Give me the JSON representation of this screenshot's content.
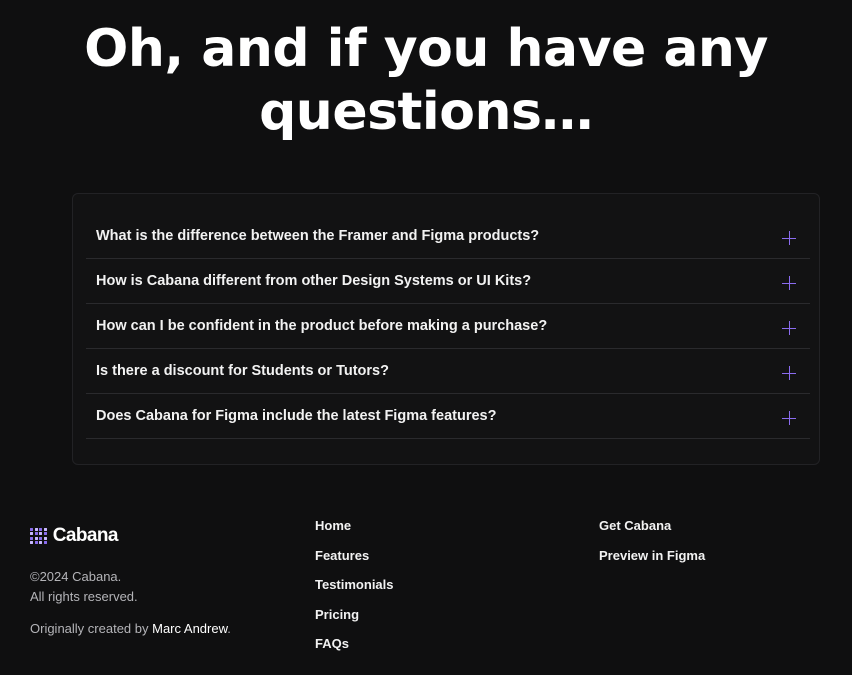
{
  "faq": {
    "title": "Oh, and if you have any questions…",
    "items": [
      {
        "question": "What is the difference between the Framer and Figma products?"
      },
      {
        "question": "How is Cabana different from other Design Systems or UI Kits?"
      },
      {
        "question": "How can I be confident in the product before making a purchase?"
      },
      {
        "question": "Is there a discount for Students or Tutors?"
      },
      {
        "question": "Does Cabana for Figma include the latest Figma features?"
      }
    ],
    "toggle_icon": "plus-icon",
    "accent_color": "#8b6cf0"
  },
  "footer": {
    "brand": {
      "name": "Cabana",
      "logo_icon": "dot-grid-logo-icon",
      "copyright_line1": "©2024 Cabana.",
      "copyright_line2": "All rights reserved.",
      "credit_prefix": "Originally created by ",
      "credit_author": "Marc Andrew",
      "credit_suffix": "."
    },
    "nav_primary": [
      {
        "label": "Home"
      },
      {
        "label": "Features"
      },
      {
        "label": "Testimonials"
      },
      {
        "label": "Pricing"
      },
      {
        "label": "FAQs"
      }
    ],
    "nav_secondary": [
      {
        "label": "Get Cabana"
      },
      {
        "label": "Preview in Figma"
      }
    ]
  },
  "colors": {
    "background": "#0f0f10",
    "card_border": "#222225",
    "divider": "#2a2a2d",
    "muted_text": "#b4b4b8"
  }
}
